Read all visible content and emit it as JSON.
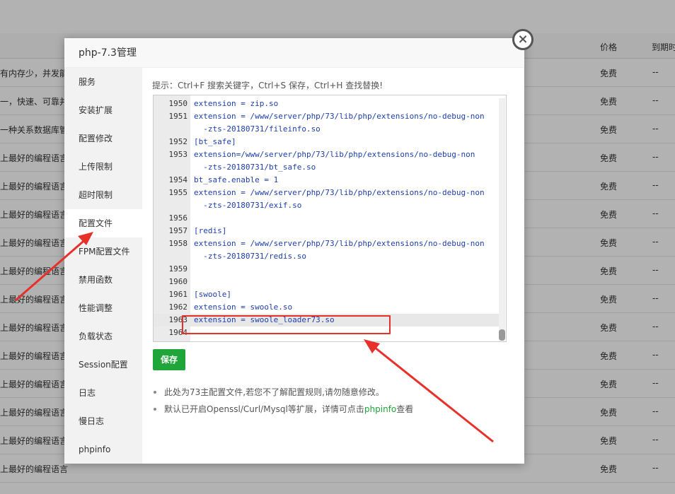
{
  "background": {
    "columns": {
      "price": "价格",
      "expire": "到期时"
    },
    "rows": [
      {
        "desc": "有内存少，并发能",
        "price": "免费",
        "expire": "--"
      },
      {
        "desc": "一，快速、可靠并",
        "price": "免费",
        "expire": "--"
      },
      {
        "desc": "一种关系数据库管理",
        "price": "免费",
        "expire": "--"
      },
      {
        "desc": "上最好的编程语言",
        "price": "免费",
        "expire": "--"
      },
      {
        "desc": "上最好的编程语言",
        "price": "免费",
        "expire": "--"
      },
      {
        "desc": "上最好的编程语言",
        "price": "免费",
        "expire": "--"
      },
      {
        "desc": "上最好的编程语言",
        "price": "免费",
        "expire": "--"
      },
      {
        "desc": "上最好的编程语言",
        "price": "免费",
        "expire": "--"
      },
      {
        "desc": "上最好的编程语言",
        "price": "免费",
        "expire": "--"
      },
      {
        "desc": "上最好的编程语言",
        "price": "免费",
        "expire": "--"
      },
      {
        "desc": "上最好的编程语言",
        "price": "免费",
        "expire": "--"
      },
      {
        "desc": "上最好的编程语言",
        "price": "免费",
        "expire": "--"
      },
      {
        "desc": "上最好的编程语言",
        "price": "免费",
        "expire": "--"
      },
      {
        "desc": "上最好的编程语言",
        "price": "免费",
        "expire": "--"
      },
      {
        "desc": "上最好的编程语言",
        "price": "免费",
        "expire": "--"
      }
    ]
  },
  "modal": {
    "title": "php-7.3管理",
    "close_icon": "×",
    "sidebar": [
      {
        "label": "服务",
        "name": "service"
      },
      {
        "label": "安装扩展",
        "name": "install-ext"
      },
      {
        "label": "配置修改",
        "name": "config-edit"
      },
      {
        "label": "上传限制",
        "name": "upload-limit"
      },
      {
        "label": "超时限制",
        "name": "timeout-limit"
      },
      {
        "label": "配置文件",
        "name": "config-file",
        "active": true
      },
      {
        "label": "FPM配置文件",
        "name": "fpm-config"
      },
      {
        "label": "禁用函数",
        "name": "disabled-functions"
      },
      {
        "label": "性能调整",
        "name": "performance"
      },
      {
        "label": "负载状态",
        "name": "load-status"
      },
      {
        "label": "Session配置",
        "name": "session-config"
      },
      {
        "label": "日志",
        "name": "log"
      },
      {
        "label": "慢日志",
        "name": "slow-log"
      },
      {
        "label": "phpinfo",
        "name": "phpinfo"
      }
    ],
    "tip": "提示：Ctrl+F 搜索关键字，Ctrl+S 保存，Ctrl+H 查找替换!",
    "editor_lines": [
      {
        "ln": "1950",
        "code": "extension = zip.so"
      },
      {
        "ln": "1951",
        "code": "extension = /www/server/php/73/lib/php/extensions/no-debug-non"
      },
      {
        "ln": "",
        "code": "  -zts-20180731/fileinfo.so"
      },
      {
        "ln": "1952",
        "code": "[bt_safe]"
      },
      {
        "ln": "1953",
        "code": "extension=/www/server/php/73/lib/php/extensions/no-debug-non"
      },
      {
        "ln": "",
        "code": "  -zts-20180731/bt_safe.so"
      },
      {
        "ln": "1954",
        "code": "bt_safe.enable = 1"
      },
      {
        "ln": "1955",
        "code": "extension = /www/server/php/73/lib/php/extensions/no-debug-non"
      },
      {
        "ln": "",
        "code": "  -zts-20180731/exif.so"
      },
      {
        "ln": "1956",
        "code": ""
      },
      {
        "ln": "1957",
        "code": "[redis]"
      },
      {
        "ln": "1958",
        "code": "extension = /www/server/php/73/lib/php/extensions/no-debug-non"
      },
      {
        "ln": "",
        "code": "  -zts-20180731/redis.so"
      },
      {
        "ln": "1959",
        "code": ""
      },
      {
        "ln": "1960",
        "code": ""
      },
      {
        "ln": "1961",
        "code": "[swoole]"
      },
      {
        "ln": "1962",
        "code": "extension = swoole.so"
      },
      {
        "ln": "1963",
        "code": "extension = swoole_loader73.so",
        "highlight": true
      },
      {
        "ln": "1964",
        "code": ""
      }
    ],
    "save_label": "保存",
    "note1": "此处为73主配置文件,若您不了解配置规则,请勿随意修改。",
    "note2_prefix": "默认已开启Openssl/Curl/Mysql等扩展，详情可点击",
    "note2_link": "phpinfo",
    "note2_suffix": "查看"
  },
  "colors": {
    "accent": "#20a53a",
    "annotation": "#e8302a",
    "code": "#1f3faa"
  }
}
